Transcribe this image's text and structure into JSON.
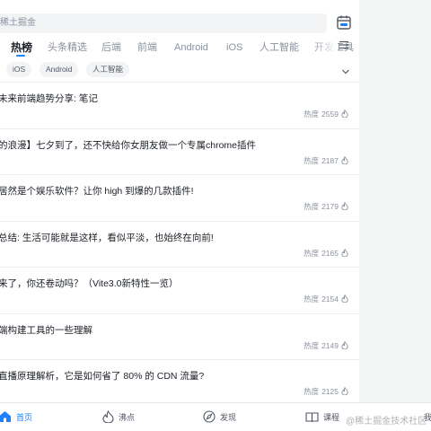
{
  "header": {
    "search": {
      "placeholder": "稀土掘金"
    },
    "tabs": [
      "热榜",
      "头条精选",
      "后端",
      "前端",
      "Android",
      "iOS",
      "人工智能",
      "开发工具"
    ],
    "chips": [
      "iOS",
      "Android",
      "人工智能"
    ]
  },
  "articles": [
    {
      "title": "未来前端趋势分享: 笔记",
      "heat_label": "热度",
      "heat": "2559"
    },
    {
      "title": "的浪漫】七夕到了，还不快给你女朋友做一个专属chrome插件",
      "heat_label": "热度",
      "heat": "2187"
    },
    {
      "title": "居然是个娱乐软件？让你 high 到爆的几款插件!",
      "heat_label": "热度",
      "heat": "2179"
    },
    {
      "title": "总结: 生活可能就是这样，看似平淡，也始终在向前!",
      "heat_label": "热度",
      "heat": "2165"
    },
    {
      "title": "来了，你还卷动吗？（Vite3.0新特性一览）",
      "heat_label": "热度",
      "heat": "2154"
    },
    {
      "title": "端构建工具的一些理解",
      "heat_label": "热度",
      "heat": "2149"
    },
    {
      "title": "直播原理解析，它是如何省了 80% 的 CDN 流量?",
      "heat_label": "热度",
      "heat": "2125"
    }
  ],
  "tabbar": {
    "home": "首页",
    "hot": "沸点",
    "discover": "发现",
    "course": "课程",
    "mine": "我"
  },
  "watermark": "@稀土掘金技术社区",
  "colors": {
    "accent": "#1e80ff",
    "text": "#1d2129",
    "muted": "#8a919f"
  }
}
